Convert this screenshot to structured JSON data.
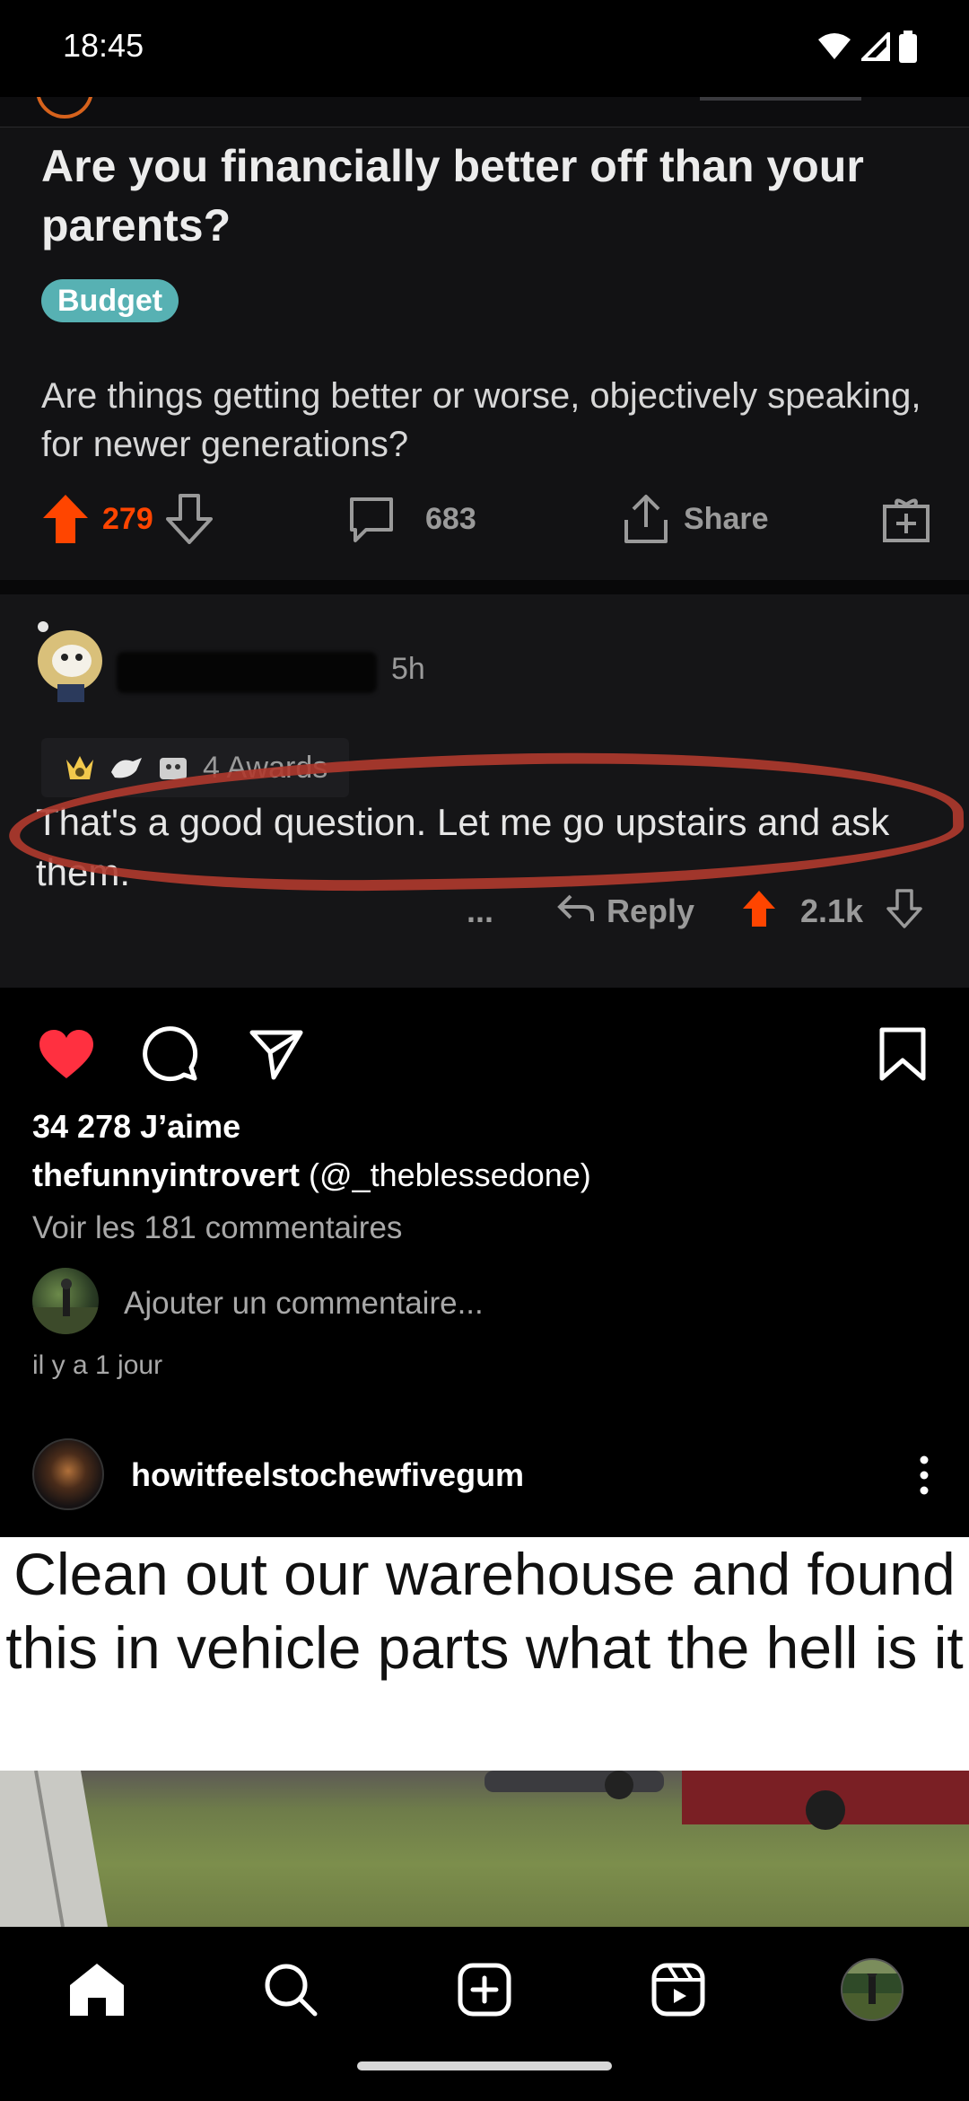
{
  "status_bar": {
    "time": "18:45"
  },
  "reddit": {
    "title": "Are you financially better off than your parents?",
    "flair": "Budget",
    "body": "Are things getting better or worse, objectively speaking, for newer generations?",
    "upvotes": "279",
    "comments": "683",
    "share_label": "Share",
    "comment_time": "5h",
    "awards": "4 Awards",
    "comment_text": "That's a good question. Let me go upstairs and ask them.",
    "more": "...",
    "reply_label": "Reply",
    "comment_score": "2.1k",
    "colors": {
      "upvote": "#ff4500",
      "flair": "#57b1b3",
      "circle": "#b03a2e"
    }
  },
  "post": {
    "likes": "34 278 J’aime",
    "caption_user": "thefunnyintrovert",
    "caption_text": "(@_theblessedone)",
    "view_comments": "Voir les 181 commentaires",
    "add_comment_placeholder": "Ajouter un commentaire...",
    "time_ago": "il y a 1 jour",
    "liked": true,
    "icons": [
      "heart-icon",
      "comment-icon",
      "share-icon",
      "bookmark-icon"
    ]
  },
  "next_post": {
    "username": "howitfeelstochewfivegum",
    "meme_text": "Clean out our warehouse and found this in vehicle parts what the hell is it"
  },
  "bottom_nav": {
    "items": [
      "home-icon",
      "search-icon",
      "create-icon",
      "reels-icon",
      "profile-avatar"
    ],
    "active": "home-icon"
  }
}
